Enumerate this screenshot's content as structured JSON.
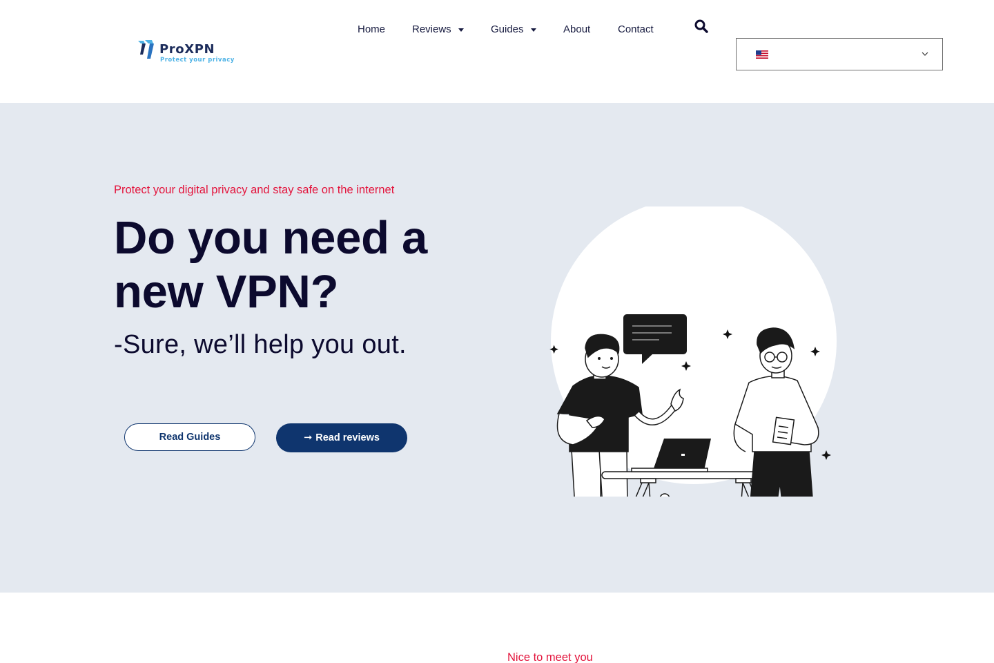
{
  "brand": {
    "name": "ProXPN",
    "tagline": "Protect your privacy",
    "colors": {
      "navy": "#1c2c5b",
      "cyan": "#4fb3e6"
    }
  },
  "nav": {
    "items": [
      {
        "label": "Home",
        "has_dropdown": false
      },
      {
        "label": "Reviews",
        "has_dropdown": true
      },
      {
        "label": "Guides",
        "has_dropdown": true
      },
      {
        "label": "About",
        "has_dropdown": false
      },
      {
        "label": "Contact",
        "has_dropdown": false
      }
    ],
    "search_icon": "search-icon"
  },
  "language_selector": {
    "selected_flag": "us-flag-icon",
    "chevron_icon": "chevron-down-icon"
  },
  "hero": {
    "eyebrow": "Protect your digital privacy and stay safe on the internet",
    "headline": "Do you need a new VPN?",
    "subheadline": "-Sure, we’ll help you out.",
    "buttons": {
      "secondary": "Read Guides",
      "primary": "Read reviews",
      "primary_icon": "arrow-right-icon"
    },
    "background_color": "#e4e9f0",
    "illustration": "two-people-with-laptop-illustration"
  },
  "intro": {
    "kicker": "Nice to meet you"
  },
  "theme": {
    "accent_red": "#e3143c",
    "primary_navy": "#0f356e",
    "text_dark": "#0c0a2e"
  }
}
